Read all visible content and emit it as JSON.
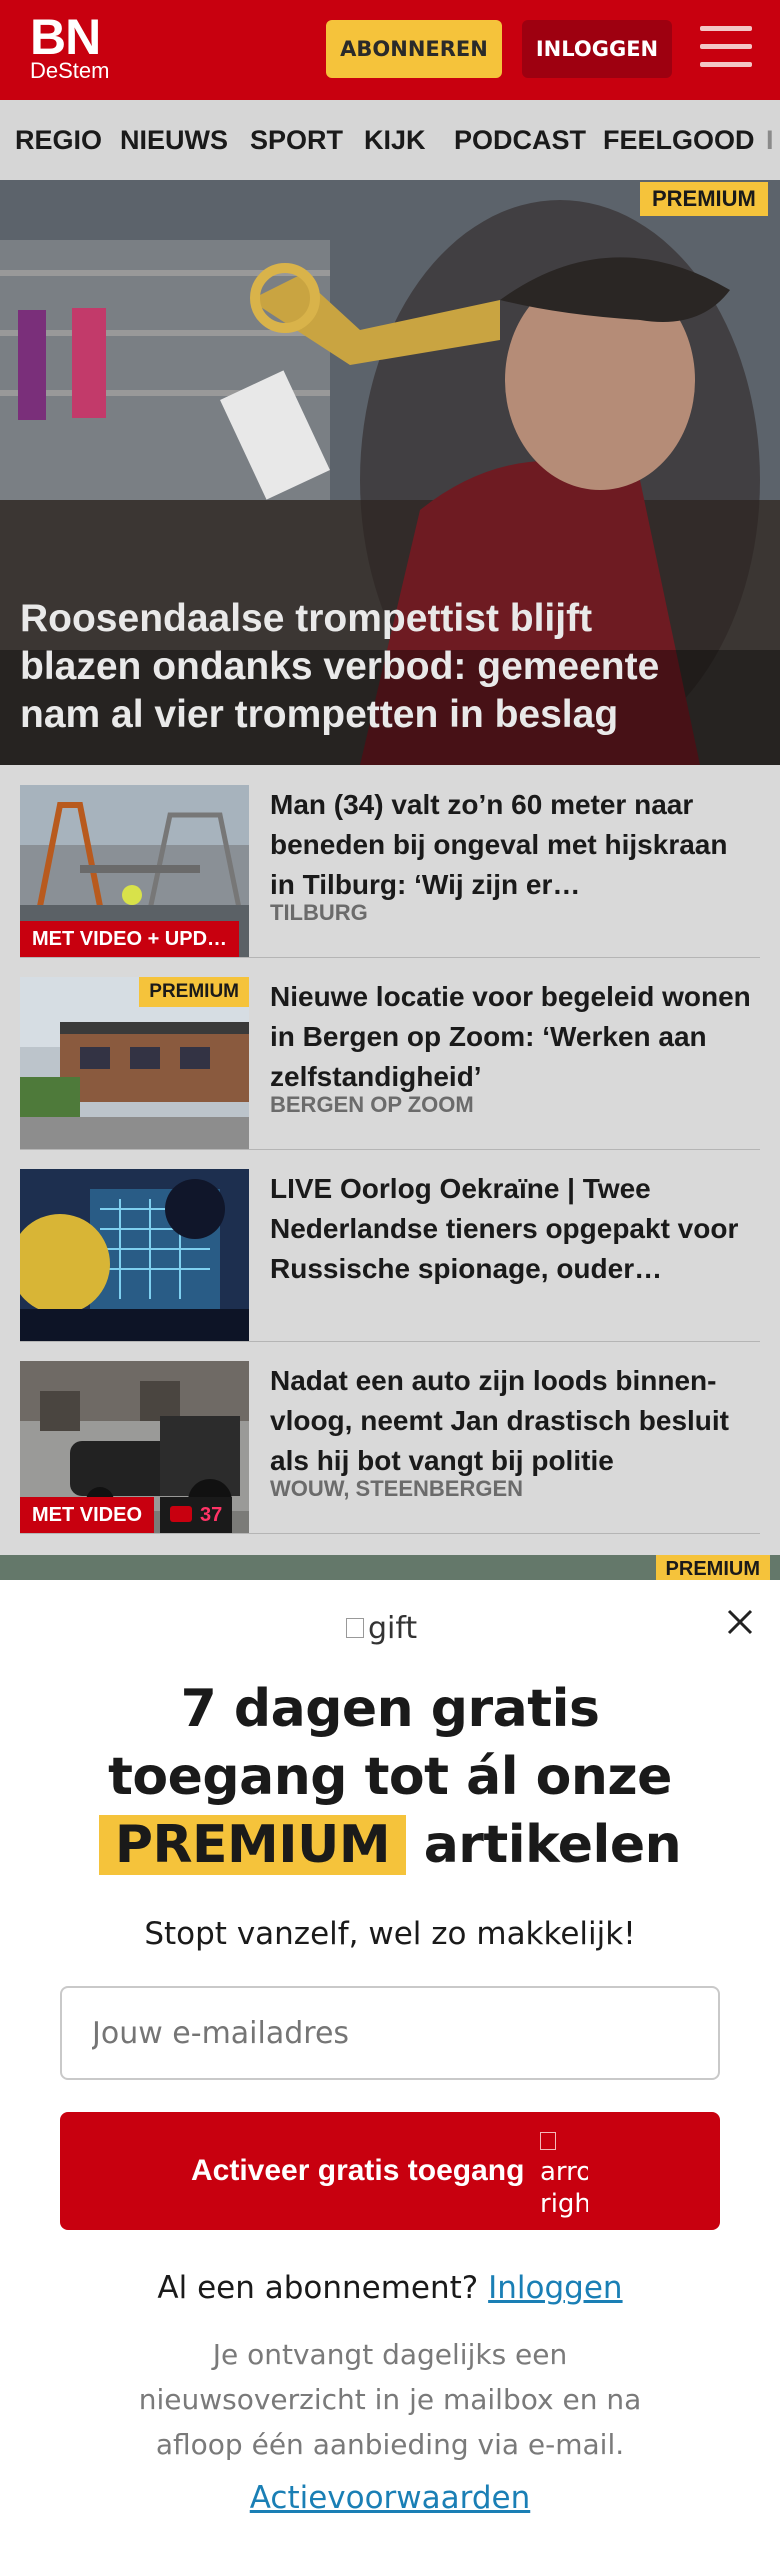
{
  "header": {
    "logo_main": "BN",
    "logo_sub": "DeStem",
    "subscribe_label": "ABONNEREN",
    "login_label": "INLOGGEN",
    "menu_icon": "hamburger-menu-icon"
  },
  "nav": {
    "items": [
      "REGIO",
      "NIEUWS",
      "SPORT",
      "KIJK",
      "PODCAST",
      "FEELGOOD",
      "I"
    ]
  },
  "hero": {
    "badge": "PREMIUM",
    "title": "Roosendaalse trompettist blijft blazen ondanks verbod: gemeente nam al vier trompetten in beslag"
  },
  "articles": [
    {
      "title": "Man (34) valt zo’n 60 meter naar beneden bij ongeval met hijskraan in Tilburg: ‘Wij zijn er…",
      "tag": "TILBURG",
      "label": "MET VIDEO + UPD…"
    },
    {
      "title": "Nieuwe locatie voor begeleid wonen in Bergen op Zoom: ‘Werken aan zelfstandigheid’",
      "tag": "BERGEN OP ZOOM",
      "badge": "PREMIUM"
    },
    {
      "title": "LIVE Oorlog Oekraïne | Twee Nederlandse tieners opgepakt voor Russische spionage, ouder…"
    },
    {
      "title": "Nadat een auto zijn loods binnen­vloog, neemt Jan drastisch besluit als hij bot vangt bij politie",
      "tag": "WOUW, STEENBERGEN",
      "label": "MET VIDEO",
      "comments": "37"
    }
  ],
  "next_teaser": {
    "badge": "PREMIUM"
  },
  "modal": {
    "gift_alt": "gift",
    "headline_line1": "7 dagen gratis",
    "headline_line2": "toegang tot ál onze",
    "headline_premium": "PREMIUM",
    "headline_end": "artikelen",
    "subline": "Stopt vanzelf, wel zo makkelijk!",
    "email_placeholder": "Jouw e-mailadres",
    "cta_label": "Activeer gratis toegang",
    "cta_arrow_alt": "arrow right",
    "already_text": "Al een abonnement?",
    "already_link": "Inloggen",
    "info": "Je ontvangt dagelijks een nieuwsoverzicht in je mailbox en na afloop één aanbieding via e-mail.",
    "terms": "Actievoorwaarden"
  },
  "colors": {
    "brand_red": "#c8000f",
    "premium_yellow": "#f5c33b",
    "link_blue": "#1a7fb5"
  }
}
